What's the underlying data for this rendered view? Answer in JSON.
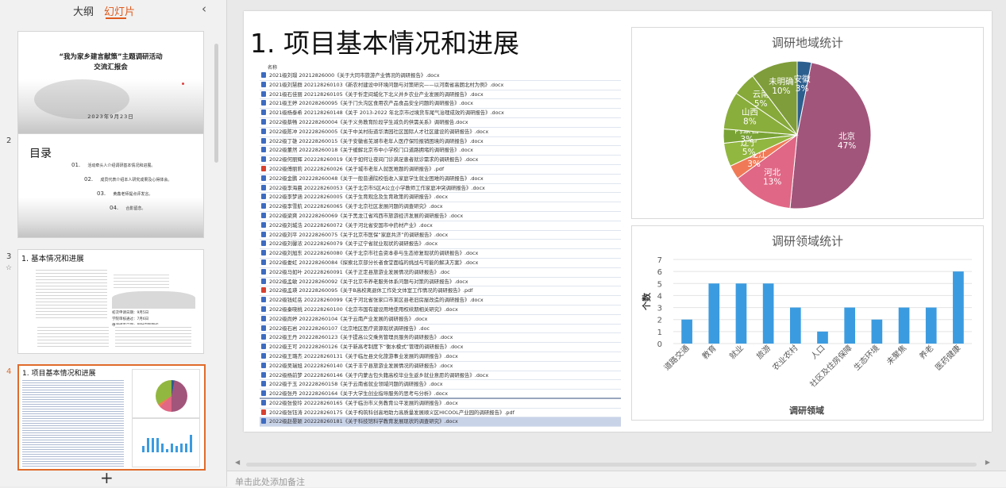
{
  "sidebar": {
    "tabs": {
      "outline": "大纲",
      "slides": "幻灯片"
    },
    "collapse_icon": "‹",
    "add_icon": "+",
    "thumbs": [
      {
        "number": "",
        "title": "“我为家乡建言献策”主题调研活动",
        "subtitle": "交流汇报会",
        "date": "2023年9月23日"
      },
      {
        "number": "2",
        "title": "目录",
        "items": [
          {
            "num": "01.",
            "text": "活动牵头人介绍调研基本情况和进展。"
          },
          {
            "num": "02.",
            "text": "成员代表介绍本人研究成果及心得体会。"
          },
          {
            "num": "03.",
            "text": "黄鑫老师提点评发言。"
          },
          {
            "num": "04.",
            "text": "合影留念。"
          }
        ]
      },
      {
        "number": "3",
        "title": "1. 基本情况和进展",
        "notes": [
          "初次申请日期：9月5日",
          "学院审核通过：7月6日",
          "申请结束日期：到时学期期初"
        ]
      },
      {
        "number": "4",
        "title": "1. 项目基本情况和进展"
      }
    ]
  },
  "slide": {
    "title": "1. 项目基本情况和进展",
    "list_header": "名称",
    "files": [
      {
        "name": "2021级刘璟 20212826000《关于大同市旅游产业情况的调研报告》.docx",
        "type": "docx"
      },
      {
        "name": "2021级刘慧群 202128260103《新农村建设中环境问题与对策研究——以河南省高朗北村为例》.docx",
        "type": "docx"
      },
      {
        "name": "2021级石佳丽 202128260105《关于忻定间城化下北义并乡农业产业发展的调研报告》.docx",
        "type": "docx"
      },
      {
        "name": "2021级王婷 202028260095《关于门头沟区食用农产品食品安全问题的调研报告》.docx",
        "type": "docx"
      },
      {
        "name": "2021级杨泰希 202128260148《关于 2013-2022 年北京市过境货车尾气治理成效的调研报告》.docx",
        "type": "docx"
      },
      {
        "name": "2022级蔡畅 202228260004《关于义务教育阶段学生减负的供需关系》调研报告.docx",
        "type": "docx"
      },
      {
        "name": "2022级陈冲 202228260005《关于中关村街道华清园社区国际人才社区建设的调研报告》.docx",
        "type": "docx"
      },
      {
        "name": "2022级丁雄 202228260015《关于安徽省芜湖市老年人医疗保险报销困境的调研报告》.docx",
        "type": "docx"
      },
      {
        "name": "2022级董然 202228260018《关于缓解北京市中小学校门口道路拥堵的调研报告》.docx",
        "type": "docx"
      },
      {
        "name": "2022级何丽辉 202228260019《关于如何让夜间门诊满足患者就诊需求的调研报告》.docx",
        "type": "docx"
      },
      {
        "name": "2022级傅丽莉 202228260026《关于城市老年人就医难题的调研报告》.pdf",
        "type": "pdf"
      },
      {
        "name": "2022级金鹏 202228260048《关于一般普通院校低收入家庭学生就业困难的调研报告》.docx",
        "type": "docx"
      },
      {
        "name": "2022级李海晨 202228260053《关于北京市S区A公立小学教师工作家庭冲突调研报告》.docx",
        "type": "docx"
      },
      {
        "name": "2022级李梦涵 202228260005《关于生育观念及生育政策的调研报告》.docx",
        "type": "docx"
      },
      {
        "name": "2022级李雪航 202228260065《关于北京社区发展问题的调查研究》.docx",
        "type": "docx"
      },
      {
        "name": "2022级梁爽 202228260069《关于黑龙江省鸡西市旅游经济发展的调研报告》.docx",
        "type": "docx"
      },
      {
        "name": "2022级刘城浩 202228260072《关于河北省安国市中药材产业》.docx",
        "type": "docx"
      },
      {
        "name": "2022级刘平 202228260075《关于北京市医保“家庭共济”的调研报告》.docx",
        "type": "docx"
      },
      {
        "name": "2022级刘馨浓 202228260079《关于辽宁省就业现状的调研报告》.docx",
        "type": "docx"
      },
      {
        "name": "2022级刘旭东 202228260080《关于北京市社会资本参与生态修复现状的调研报告》.docx",
        "type": "docx"
      },
      {
        "name": "2022级娄虹 202228260084《探索北京部分长者食堂面临的挑战与可能的解决方案》.docx",
        "type": "docx"
      },
      {
        "name": "2022级马如叶 202228260091《关于正定县旅游业发展情况的调研报告》.doc",
        "type": "docx"
      },
      {
        "name": "2022级孟敏 202228260092《关于北京市养老服务体系问题与对策的调研报告》.docx",
        "type": "docx"
      },
      {
        "name": "2022级孟瑛 202228260095《关于B高校离退休工作处文体室工作情况的调研报告》.pdf",
        "type": "pdf"
      },
      {
        "name": "2022级钱虹岳 202228260099《关于河北省张家口市某区县老旧房屋改造的调研报告》.docx",
        "type": "docx"
      },
      {
        "name": "2022级秦晓桃 202228260100《北京市国有建设用地使用权续期相关研究》.docx",
        "type": "docx"
      },
      {
        "name": "2022级尚婷 202228260104《关于云南产业发展的调研报告》.docx",
        "type": "docx"
      },
      {
        "name": "2022级石岩 202228260107《北京地区医疗资源现状调研报告》.doc",
        "type": "docx"
      },
      {
        "name": "2022级王丹 202228260123《关于提高公交乘务管理员服务的调研报告》.docx",
        "type": "docx"
      },
      {
        "name": "2022级王可 202228260126《关于新高考制度下“衡水模式”管理的调研报告》.docx",
        "type": "docx"
      },
      {
        "name": "2022级王璐杰 202228260131《关于临左县文化旅游事业发展的调研报告》.docx",
        "type": "docx"
      },
      {
        "name": "2022级吴瑞旭 202228260140《关于丰宁县旅游业发展情况的调研报告》.docx",
        "type": "docx"
      },
      {
        "name": "2022级杨前梦 202228260146《关于内蒙古包头籍高校毕业生返乡就业意愿的调研报告》.docx",
        "type": "docx"
      },
      {
        "name": "2022级于玉 202228260158《关于云南省就业领域问题的调研报告》.docx",
        "type": "docx"
      },
      {
        "name": "2022级张丹 202228260164《关于大学生创业指导服务的思考与分析》.docx",
        "type": "docx"
      },
      {
        "name": "2022级张俊玲 202228260165《关于临汾市义务教育公平发展的调研报告》.docx",
        "type": "docx"
      },
      {
        "name": "2022级张钰涛 202228260175《关于构筑科创高地助力高质量发展顺义区HICOOL产业园的调研报告》.pdf",
        "type": "pdf"
      },
      {
        "name": "2022级赵晏颖 202228260181《关于科技馆科学教育发展现状的调查研究》.docx",
        "type": "docx"
      }
    ]
  },
  "chart_data": [
    {
      "type": "pie",
      "title": "调研地域统计",
      "categories": [
        "北京",
        "河北",
        "黑龙江",
        "辽宁",
        "内蒙古",
        "山西",
        "云南",
        "未明确",
        "安徽"
      ],
      "values": [
        47,
        13,
        3,
        5,
        3,
        8,
        5,
        10,
        3
      ],
      "labels": [
        "北京\n47%",
        "河北\n13%",
        "黑龙江\n3%",
        "辽宁\n5%",
        "内蒙古\n3%",
        "山西\n8%",
        "云南\n5%",
        "未明确\n10%",
        "安徽\n3%"
      ],
      "colors": [
        "#a2557a",
        "#e06785",
        "#f07a57",
        "#92b740",
        "#7aa336",
        "#8aae3b",
        "#86a93a",
        "#7f9d3a",
        "#2d5f8e"
      ]
    },
    {
      "type": "bar",
      "title": "调研领域统计",
      "xlabel": "调研领域",
      "ylabel": "个数",
      "categories": [
        "道路交通",
        "教育",
        "就业",
        "旅游",
        "农业农村",
        "人口",
        "社区及住房保障",
        "生态环境",
        "未聚焦",
        "养老",
        "医药健康"
      ],
      "values": [
        2,
        5,
        5,
        5,
        3,
        1,
        3,
        2,
        3,
        3,
        6
      ],
      "ylim": [
        0,
        7
      ],
      "yticks": [
        0,
        1,
        2,
        3,
        4,
        5,
        6,
        7
      ],
      "grid": true,
      "color": "#3b9be0"
    }
  ],
  "bottom": {
    "notes_placeholder": "单击此处添加备注"
  }
}
